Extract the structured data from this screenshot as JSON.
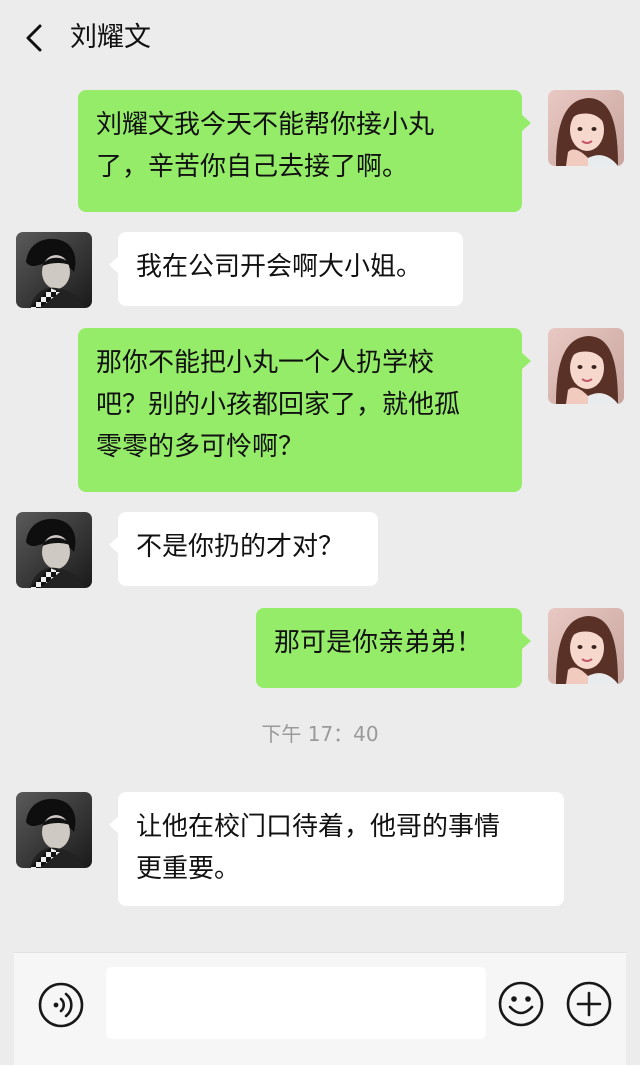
{
  "header": {
    "title": "刘耀文"
  },
  "messages": [
    {
      "side": "sent",
      "lines": [
        "刘耀文我今天不能帮你接小丸",
        "了，辛苦你自己去接了啊。"
      ]
    },
    {
      "side": "received",
      "lines": [
        "我在公司开会啊大小姐。"
      ]
    },
    {
      "side": "sent",
      "lines": [
        "那你不能把小丸一个人扔学校",
        "吧？别的小孩都回家了，就他孤",
        "零零的多可怜啊？"
      ]
    },
    {
      "side": "received",
      "lines": [
        "不是你扔的才对？"
      ]
    },
    {
      "side": "sent",
      "lines": [
        "那可是你亲弟弟！"
      ]
    },
    {
      "side": "received",
      "lines": [
        "让他在校门口待着，他哥的事情",
        "更重要。"
      ]
    }
  ],
  "timestamp": "下午 17：40",
  "input": {
    "value": "",
    "placeholder": ""
  },
  "icons": {
    "voice": "voice-icon",
    "emoji": "emoji-icon",
    "plus": "plus-icon",
    "back": "back-icon"
  },
  "colors": {
    "sent_bubble": "#95ec69",
    "received_bubble": "#ffffff",
    "background": "#ececec"
  }
}
